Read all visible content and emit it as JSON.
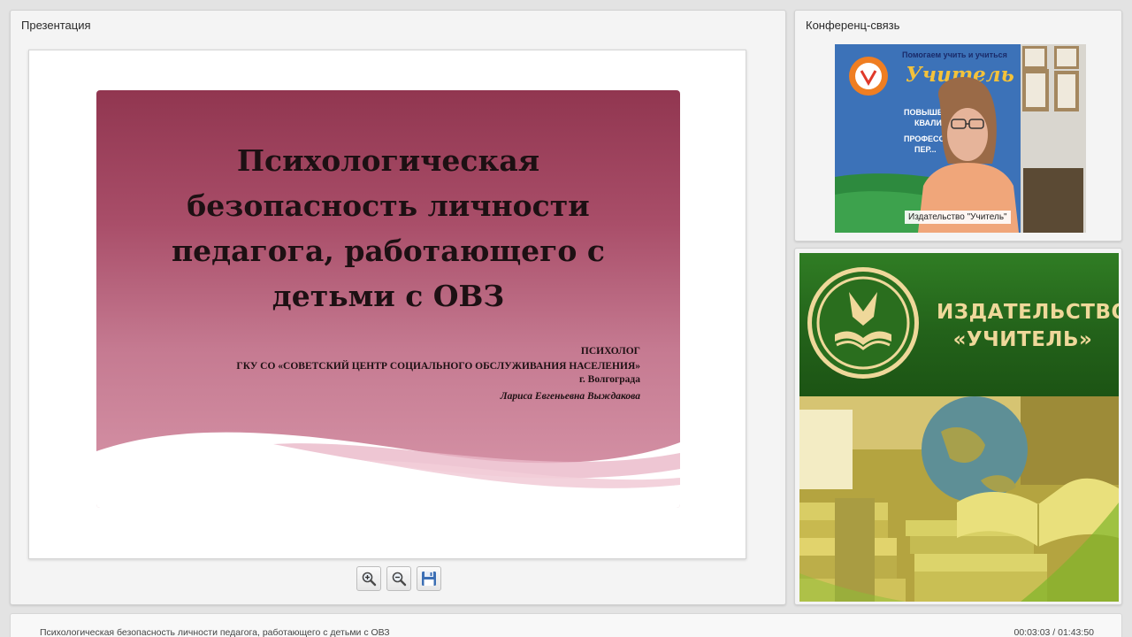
{
  "presentation": {
    "panel_title": "Презентация",
    "slide": {
      "title": "Психологическая безопасность личности педагога, работающего с детьми с ОВЗ",
      "role": "ПСИХОЛОГ",
      "organization": "ГКУ СО «СОВЕТСКИЙ ЦЕНТР СОЦИАЛЬНОГО ОБСЛУЖИВАНИЯ НАСЕЛЕНИЯ» г. Волгограда",
      "author": "Лариса Евгеньевна Выждакова"
    },
    "toolbar": {
      "zoom_in_icon": "zoom-in-icon",
      "zoom_out_icon": "zoom-out-icon",
      "save_icon": "floppy-disk-icon"
    }
  },
  "conference": {
    "panel_title": "Конференц-связь",
    "video_caption": "Издательство \"Учитель\"",
    "backdrop_text": [
      "Помогаем учить и учиться",
      "Учитель",
      "ПОВЫШЕНИ...",
      "КВАЛИФ...",
      "ПРОФЕСС...",
      "ПЕР..."
    ]
  },
  "banner": {
    "name_line1": "ИЗДАТЕЛЬСТВО",
    "name_line2": "«УЧИТЕЛЬ»"
  },
  "status": {
    "title": "Психологическая безопасность личности педагога, работающего с детьми с ОВЗ",
    "time": "00:03:03 / 01:43:50"
  },
  "colors": {
    "slide_top": "#913650",
    "slide_bottom": "#d897aa",
    "banner_green": "#2b6a1f",
    "banner_gold": "#efd89a"
  }
}
